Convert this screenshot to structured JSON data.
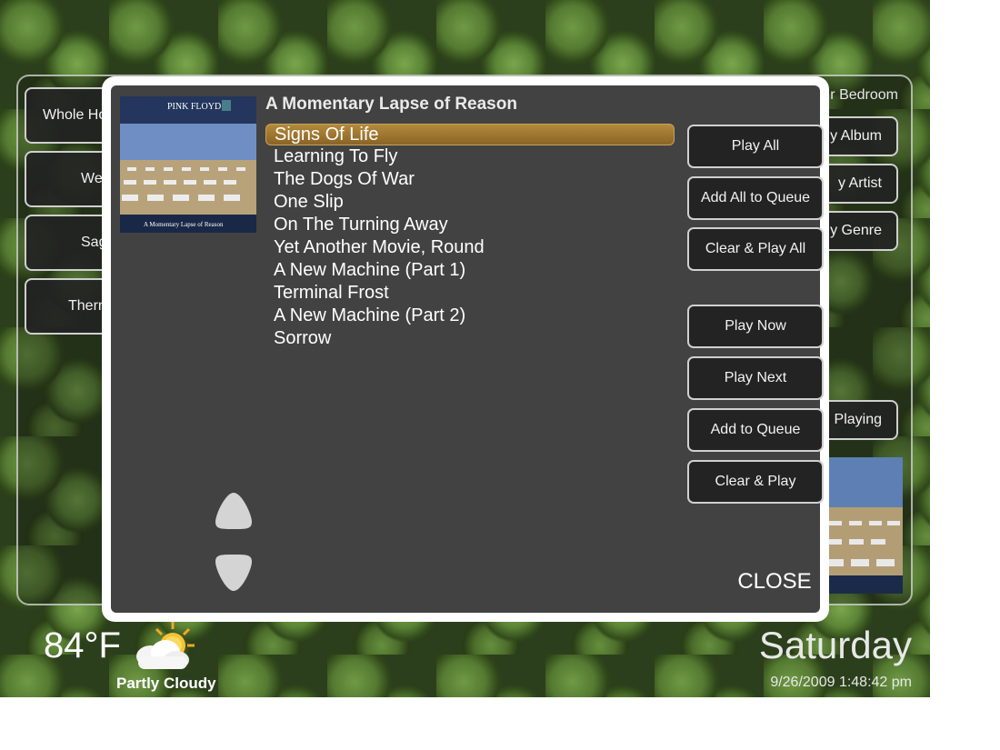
{
  "left_menu": [
    {
      "label": "Whole Ho"
    },
    {
      "label": "We"
    },
    {
      "label": "Sag"
    },
    {
      "label": "Therm"
    }
  ],
  "right_menu": {
    "room": "r Bedroom",
    "browse": [
      {
        "label": "y Album"
      },
      {
        "label": "y Artist"
      },
      {
        "label": "y Genre"
      }
    ],
    "now_playing": "Playing"
  },
  "modal": {
    "album_title": "A Momentary Lapse of Reason",
    "album_art": {
      "band": "PINK FLOYD",
      "caption": "A Momentary Lapse of Reason"
    },
    "tracks": [
      "Signs Of Life",
      "Learning To Fly",
      "The Dogs Of War",
      "One Slip",
      "On The Turning Away",
      "Yet Another Movie, Round",
      "A New Machine (Part 1)",
      "Terminal Frost",
      "A New Machine (Part 2)",
      "Sorrow"
    ],
    "selected_track_index": 0,
    "album_actions": [
      "Play All",
      "Add All to Queue",
      "Clear & Play All"
    ],
    "track_actions": [
      "Play Now",
      "Play Next",
      "Add to Queue",
      "Clear & Play"
    ],
    "close_label": "CLOSE"
  },
  "status": {
    "temperature": "84°F",
    "condition": "Partly Cloudy",
    "day": "Saturday",
    "datetime": "9/26/2009 1:48:42 pm"
  },
  "colors": {
    "modal_bg": "#424242",
    "selection": "#a07a34",
    "button_bg": "#232323"
  }
}
